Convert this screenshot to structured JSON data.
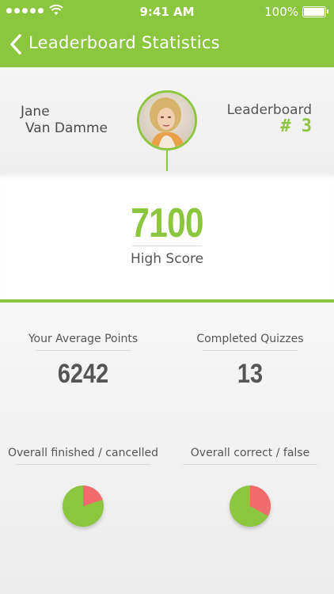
{
  "status_bar": {
    "time": "9:41 AM",
    "battery": "100%"
  },
  "nav": {
    "title": "Leaderboard Statistics"
  },
  "profile": {
    "first_name": "Jane",
    "last_name": "Van Damme",
    "leaderboard_label": "Leaderboard",
    "rank": "# 3"
  },
  "high_score": {
    "value": "7100",
    "label": "High Score"
  },
  "stats": {
    "average_points": {
      "label": "Your Average Points",
      "value": "6242"
    },
    "completed_quizzes": {
      "label": "Completed Quizzes",
      "value": "13"
    }
  },
  "pies": {
    "finished_cancelled": {
      "label": "Overall finished / cancelled",
      "finished_fraction": 0.8,
      "cancelled_fraction": 0.2
    },
    "correct_false": {
      "label": "Overall correct / false",
      "correct_fraction": 0.67,
      "false_fraction": 0.33
    }
  },
  "colors": {
    "accent": "#8cc63f",
    "negative": "#f06b6b",
    "text": "#555555"
  }
}
